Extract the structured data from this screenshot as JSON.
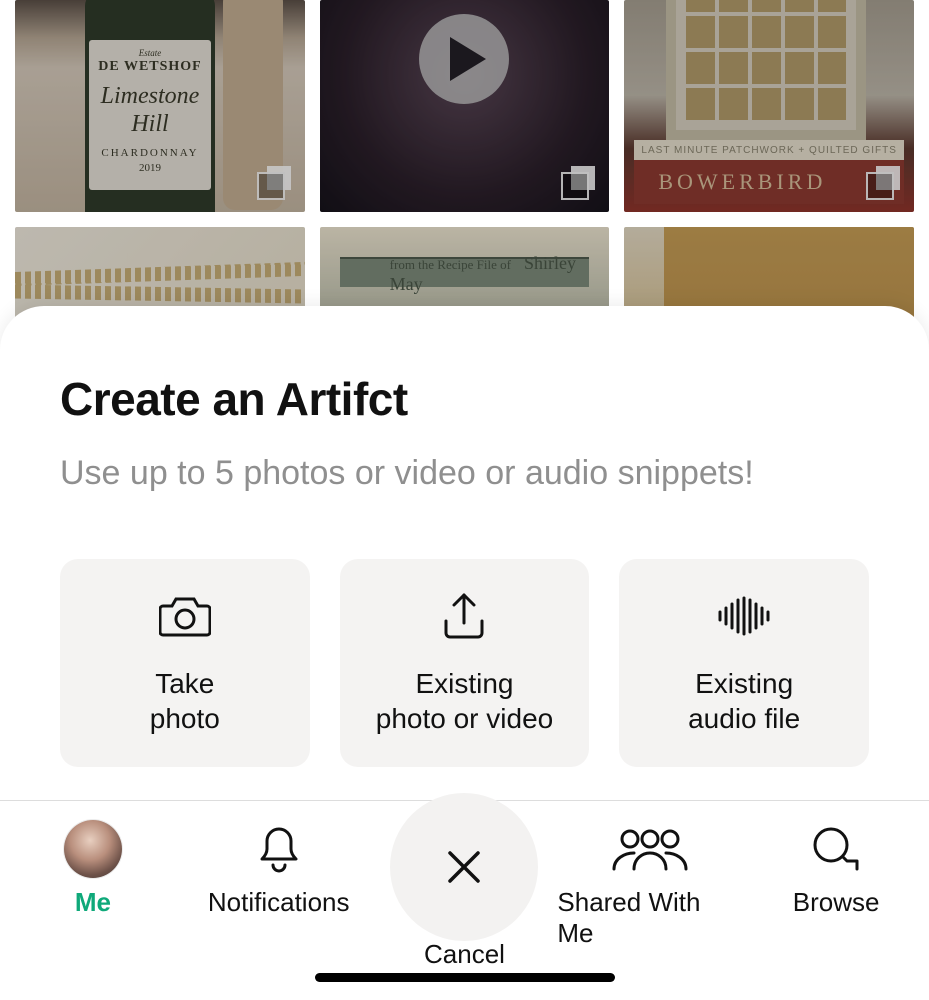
{
  "sheet": {
    "title": "Create an Artifct",
    "subtitle": "Use up to 5 photos or video or audio snippets!",
    "options": [
      {
        "label": "Take\nphoto",
        "icon": "camera-icon"
      },
      {
        "label": "Existing\nphoto or video",
        "icon": "upload-icon"
      },
      {
        "label": "Existing\naudio file",
        "icon": "audio-wave-icon"
      }
    ]
  },
  "tabs": [
    {
      "label": "Me",
      "icon": "avatar",
      "active": true
    },
    {
      "label": "Notifications",
      "icon": "bell-icon",
      "active": false
    },
    {
      "label": "Cancel",
      "icon": "close-icon",
      "active": false
    },
    {
      "label": "Shared With Me",
      "icon": "people-icon",
      "active": false
    },
    {
      "label": "Browse",
      "icon": "search-icon",
      "active": false
    }
  ],
  "colors": {
    "accent": "#0fa97a",
    "card_bg": "#f4f3f2",
    "subtitle_gray": "#8f8f8f"
  },
  "background_grid": {
    "tiles": [
      {
        "has_stack_badge": true,
        "has_play": false,
        "text_snippets": [
          "DE WETSHOF",
          "Limestone Hill",
          "CHARDONNAY",
          "2019"
        ]
      },
      {
        "has_stack_badge": true,
        "has_play": true
      },
      {
        "has_stack_badge": true,
        "has_play": false,
        "text_snippets": [
          "LAST MINUTE PATCHWORK + QUILTED GIFTS",
          "BOWERBIRD"
        ]
      },
      {
        "has_stack_badge": false,
        "has_play": false
      },
      {
        "has_stack_badge": false,
        "has_play": false,
        "text_snippets": [
          "from the Recipe File of",
          "Shirley May"
        ]
      },
      {
        "has_stack_badge": false,
        "has_play": false
      }
    ]
  }
}
